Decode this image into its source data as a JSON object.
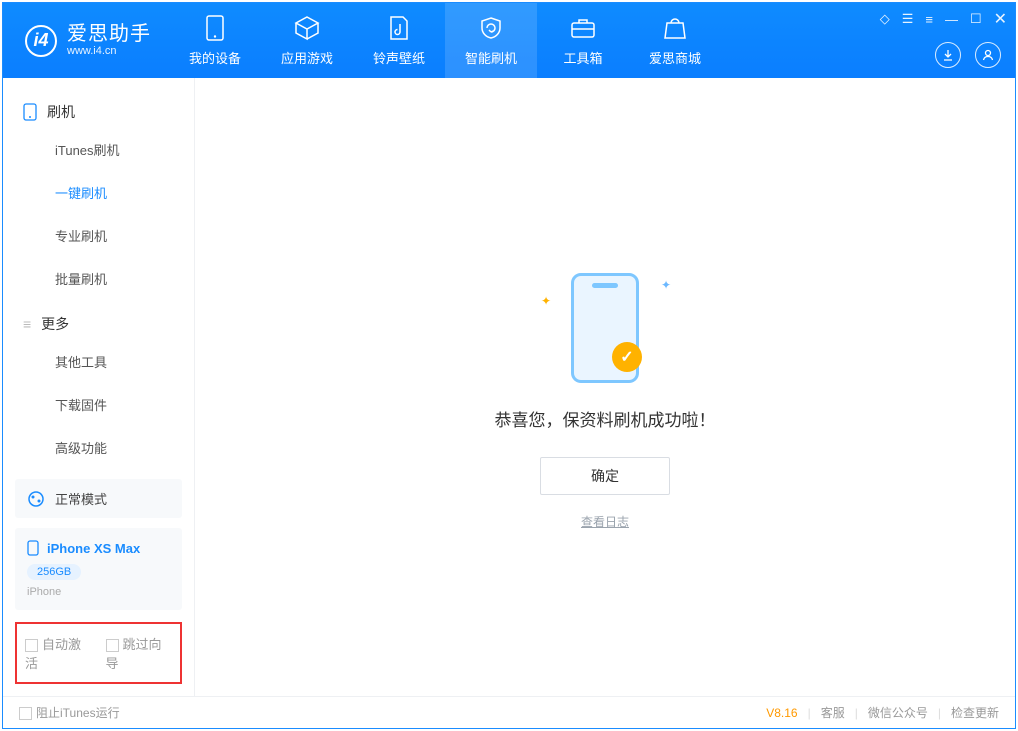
{
  "app": {
    "title": "爱思助手",
    "subtitle": "www.i4.cn"
  },
  "tabs": {
    "device": "我的设备",
    "apps": "应用游戏",
    "ring": "铃声壁纸",
    "flash": "智能刷机",
    "tools": "工具箱",
    "store": "爱思商城"
  },
  "sidebar": {
    "section_flash": "刷机",
    "items_flash": [
      "iTunes刷机",
      "一键刷机",
      "专业刷机",
      "批量刷机"
    ],
    "section_more": "更多",
    "items_more": [
      "其他工具",
      "下载固件",
      "高级功能"
    ]
  },
  "mode_label": "正常模式",
  "device": {
    "name": "iPhone XS Max",
    "storage": "256GB",
    "type": "iPhone"
  },
  "options": {
    "auto_activate": "自动激活",
    "skip_guide": "跳过向导"
  },
  "main": {
    "success_msg": "恭喜您，保资料刷机成功啦！",
    "ok": "确定",
    "view_log": "查看日志"
  },
  "status": {
    "block_itunes": "阻止iTunes运行",
    "version": "V8.16",
    "service": "客服",
    "wechat": "微信公众号",
    "update": "检查更新"
  }
}
